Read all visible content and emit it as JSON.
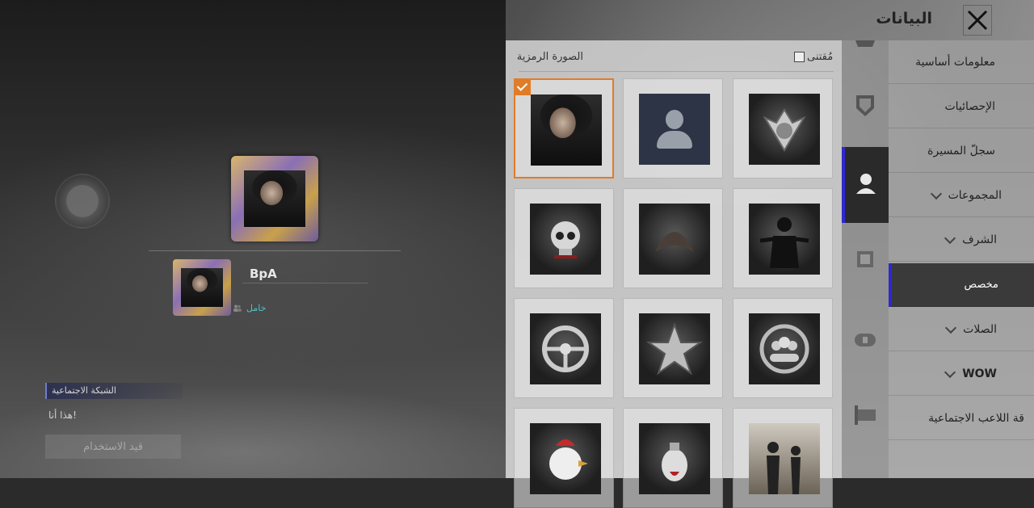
{
  "header": {
    "title": "البيانات"
  },
  "profile": {
    "player_name": "BpA",
    "status": "خامل"
  },
  "social": {
    "tab_label": "الشبكة الاجتماعية",
    "this_is_me": "هذا أنا!",
    "in_use_button": "قيد الاستخدام"
  },
  "avatar_panel": {
    "title": "الصورة الرمزية",
    "owned_label": "مُقتنى",
    "owned_checked": false,
    "selected_index": 0,
    "items": [
      {
        "name": "player-photo-avatar"
      },
      {
        "name": "default-silhouette-avatar"
      },
      {
        "name": "winged-emblem-avatar"
      },
      {
        "name": "skull-avatar"
      },
      {
        "name": "dragon-emblem-avatar"
      },
      {
        "name": "gunslinger-avatar"
      },
      {
        "name": "steering-wheel-avatar"
      },
      {
        "name": "star-medal-avatar"
      },
      {
        "name": "squad-emblem-avatar"
      },
      {
        "name": "rooster-avatar"
      },
      {
        "name": "grenade-avatar"
      },
      {
        "name": "duo-silhouette-avatar"
      }
    ]
  },
  "menu": {
    "items": [
      {
        "label": "معلومات أساسية",
        "chevron": false
      },
      {
        "label": "الإحصائيات",
        "chevron": false
      },
      {
        "label": "سجلّ المسيرة",
        "chevron": false
      },
      {
        "label": "المجموعات",
        "chevron": true
      },
      {
        "label": "الشرف",
        "chevron": true
      },
      {
        "label": "مخصص",
        "chevron": false,
        "active": true
      },
      {
        "label": "الصلات",
        "chevron": true
      },
      {
        "label": "WOW",
        "chevron": true
      },
      {
        "label": "قة اللاعب الاجتماعية",
        "chevron": false
      }
    ]
  },
  "colors": {
    "accent": "#2f27d1",
    "selection": "#e07c28",
    "status": "#4fc0c9"
  }
}
